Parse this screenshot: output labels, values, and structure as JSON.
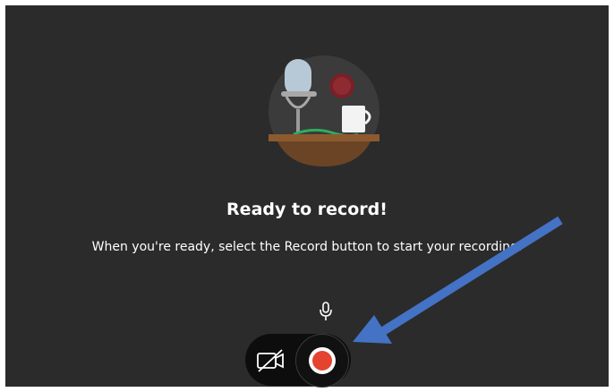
{
  "recorder": {
    "title": "Ready to record!",
    "subtitle": "When you're ready, select the Record button to start your recording.",
    "icons": {
      "illustration": "podcast-desk-illustration",
      "microphone": "microphone-icon",
      "camera": "camera-off-icon",
      "record": "record-icon"
    }
  },
  "colors": {
    "background": "#2b2b2b",
    "text": "#ffffff",
    "record": "#e4432f",
    "annotation_arrow": "#4472c4"
  }
}
